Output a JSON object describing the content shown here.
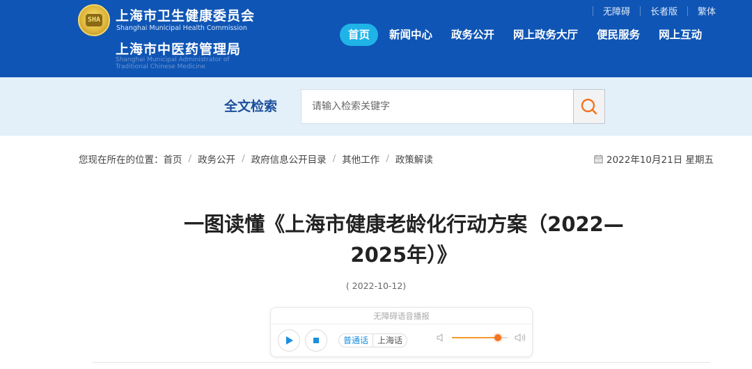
{
  "header": {
    "emblem_text": "SHA",
    "org_name_cn": "上海市卫生健康委员会",
    "org_name_en": "Shanghai Municipal Health Commission",
    "org2_name_cn": "上海市中医药管理局",
    "org2_name_en": "Shanghai Municipal Administrator of Traditional Chinese Medicine",
    "top_links": [
      "无障碍",
      "长者版",
      "繁体"
    ],
    "nav": [
      "首页",
      "新闻中心",
      "政务公开",
      "网上政务大厅",
      "便民服务",
      "网上互动"
    ],
    "active_nav": 0
  },
  "search": {
    "label": "全文检索",
    "placeholder": "请输入检索关键字"
  },
  "breadcrumb": {
    "prefix": "您现在所在的位置：",
    "items": [
      "首页",
      "政务公开",
      "政府信息公开目录",
      "其他工作",
      "政策解读"
    ]
  },
  "date_display": "2022年10月21日 星期五",
  "article": {
    "title_line1": "一图读懂《上海市健康老龄化行动方案（2022—",
    "title_line2": "2025年）》",
    "pub_date": "( 2022-10-12)"
  },
  "player": {
    "title": "无障碍语音播报",
    "lang_on": "普通话",
    "lang_off": "上海话",
    "volume": 0.82
  },
  "colors": {
    "header_bg": "#0f55b5",
    "nav_active": "#1fb3e8",
    "search_band": "#e4f0f9",
    "search_icon": "#f37421"
  }
}
